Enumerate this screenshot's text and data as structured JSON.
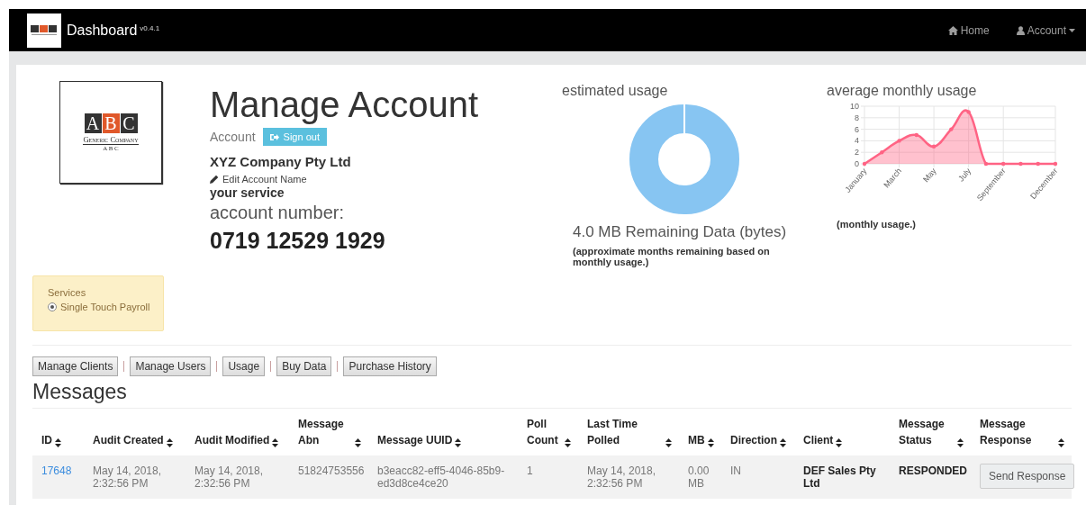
{
  "navbar": {
    "brand": "Dashboard",
    "version": "v0.4.1",
    "links": [
      {
        "label": "Home"
      },
      {
        "label": "Account",
        "dropdown": true
      }
    ]
  },
  "logo": {
    "letters": [
      "A",
      "B",
      "C"
    ],
    "name": "Generic Company",
    "sub": "A B C"
  },
  "account": {
    "title": "Manage Account",
    "label": "Account",
    "sign_out": "Sign out",
    "company": "XYZ Company Pty Ltd",
    "edit_link": "Edit Account Name",
    "service": "your service",
    "number_label": "account number:",
    "number": "0719 12529 1929"
  },
  "services": {
    "title": "Services",
    "items": [
      {
        "label": "Single Touch Payroll",
        "selected": true
      }
    ]
  },
  "estimated": {
    "title": "estimated usage",
    "remaining": "4.0 MB Remaining Data (bytes)",
    "note": "(approximate months remaining based on monthly usage.)"
  },
  "monthly": {
    "title": "average monthly usage",
    "note": "(monthly usage.)",
    "chart_data": {
      "type": "area",
      "categories": [
        "January",
        null,
        "March",
        null,
        "May",
        null,
        "July",
        null,
        "September",
        null,
        null,
        "December"
      ],
      "series": [
        {
          "color": "#ff6384",
          "values": [
            0,
            2,
            4,
            5,
            3,
            6,
            9,
            0,
            0,
            0,
            0,
            0
          ]
        }
      ],
      "ylim": [
        0,
        10
      ],
      "yticks": [
        0,
        2,
        4,
        6,
        8,
        10
      ],
      "grid": true
    }
  },
  "actions": [
    "Manage Clients",
    "Manage Users",
    "Usage",
    "Buy Data",
    "Purchase History"
  ],
  "messages": {
    "title": "Messages",
    "columns": [
      "ID",
      "Audit Created",
      "Audit Modified",
      "Message Abn",
      "Message UUID",
      "Poll Count",
      "Last Time Polled",
      "MB",
      "Direction",
      "Client",
      "Message Status",
      "Message Response"
    ],
    "rows": [
      {
        "id": "17648",
        "audit_created": "May 14, 2018, 2:32:56 PM",
        "audit_modified": "May 14, 2018, 2:32:56 PM",
        "abn": "51824753556",
        "uuid": "b3eacc82-eff5-4046-85b9-ed3d8ce4ce20",
        "poll_count": "1",
        "last_polled": "May 14, 2018, 2:32:56 PM",
        "mb": "0.00 MB",
        "direction": "IN",
        "client": "DEF Sales Pty Ltd",
        "status": "RESPONDED",
        "response": "Send Response"
      }
    ]
  }
}
